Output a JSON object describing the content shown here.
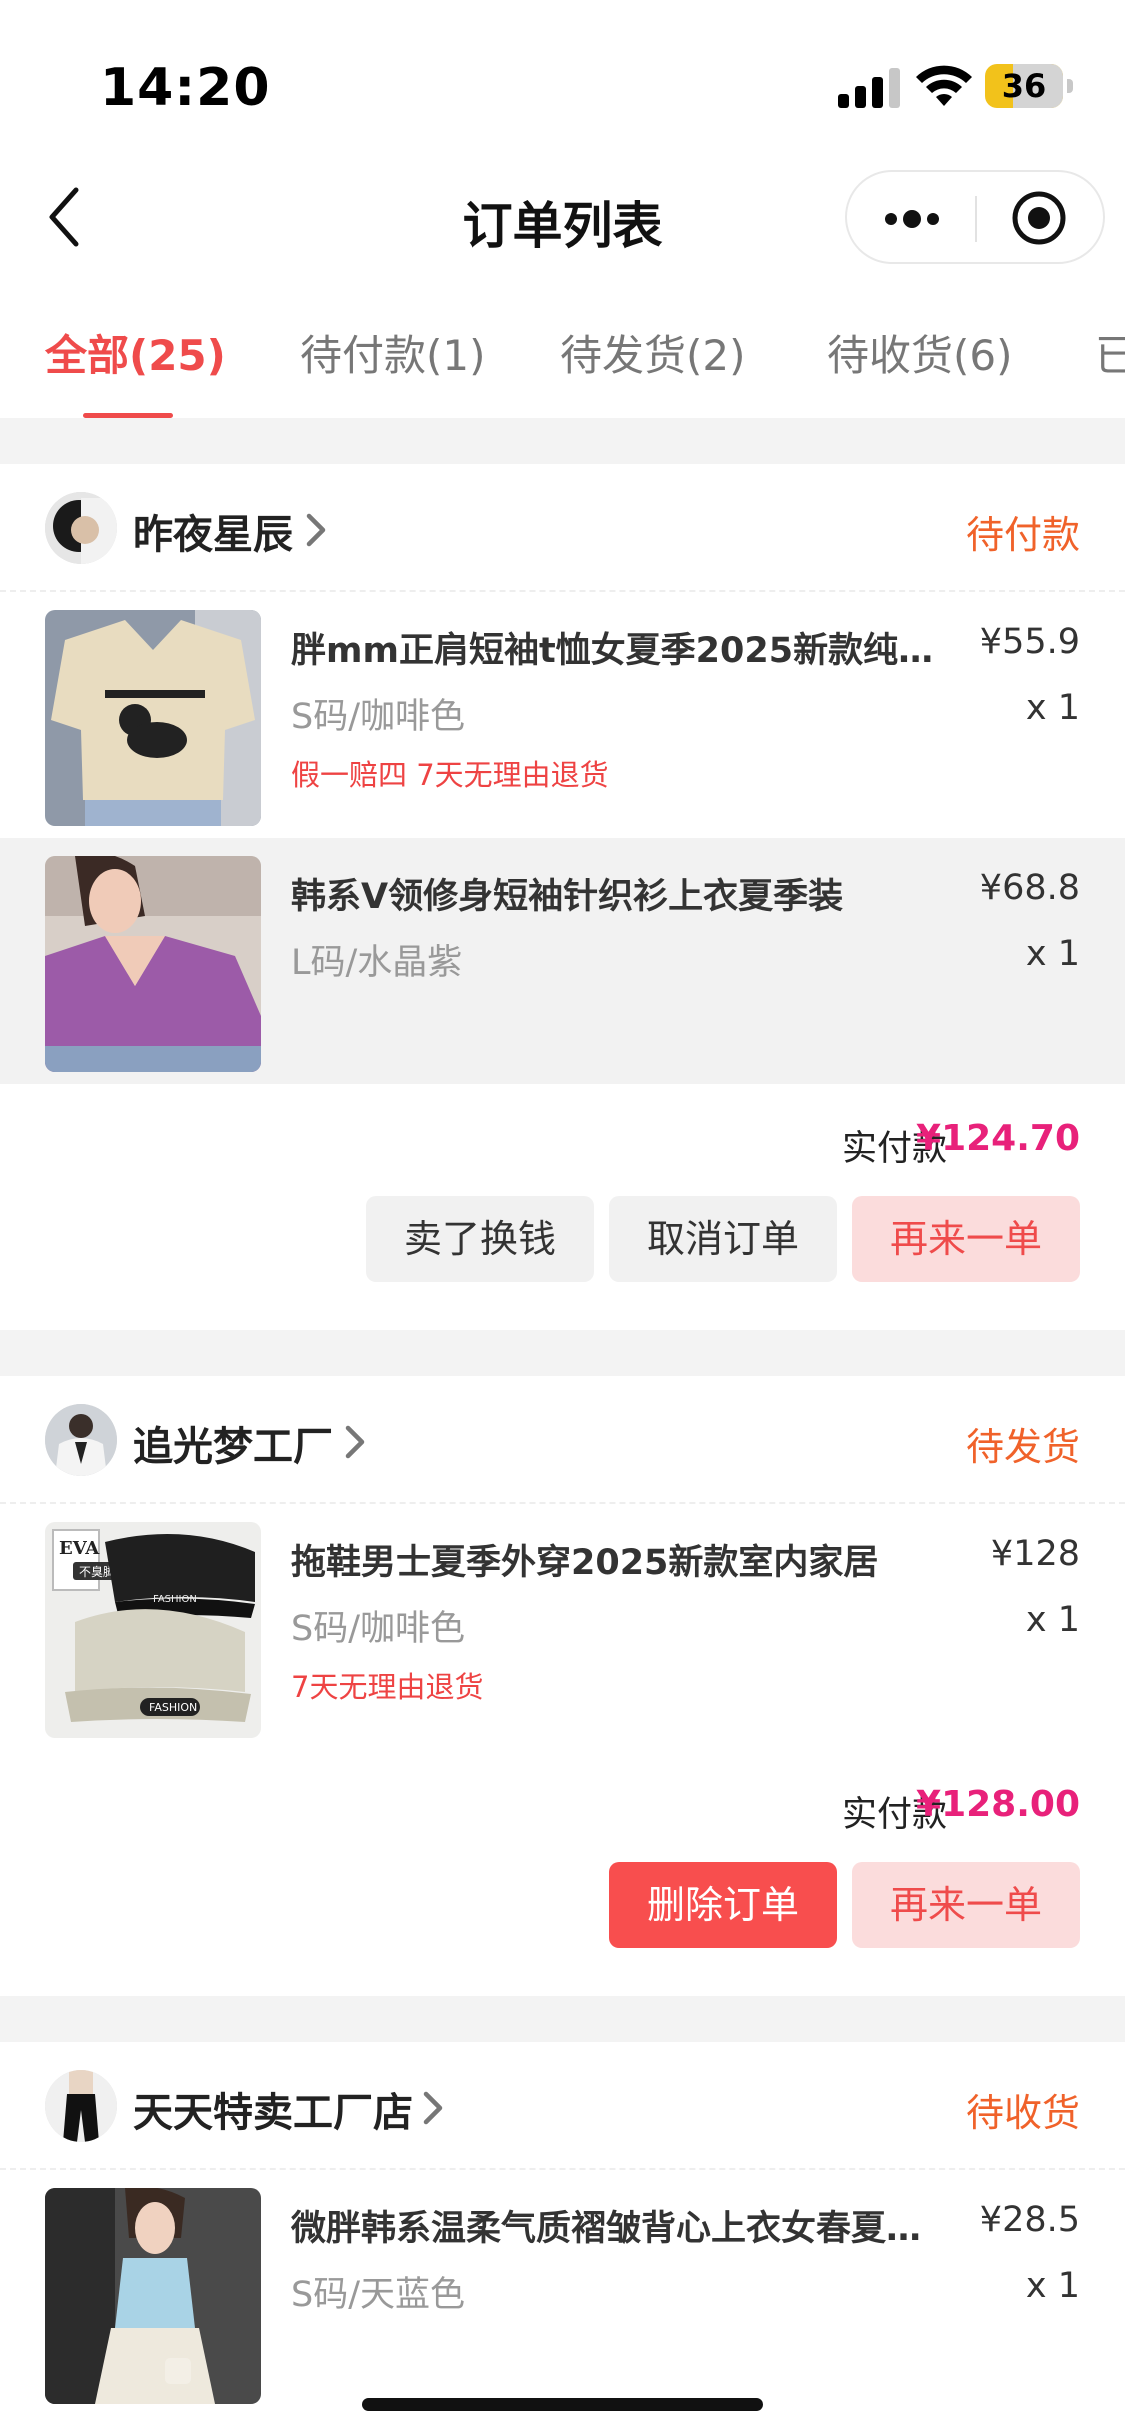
{
  "status_bar": {
    "time": "14:20",
    "battery": "36",
    "battery_color": "#f2c21b"
  },
  "nav": {
    "title": "订单列表"
  },
  "tabs": [
    {
      "label": "全部(25)",
      "active": true
    },
    {
      "label": "待付款(1)"
    },
    {
      "label": "待发货(2)"
    },
    {
      "label": "待收货(6)"
    },
    {
      "label": "已"
    }
  ],
  "orders": [
    {
      "shop": "昨夜星辰",
      "status": "待付款",
      "items": [
        {
          "title": "胖mm正肩短袖t恤女夏季2025新款纯棉…",
          "price": "¥55.9",
          "spec": "S码/咖啡色",
          "qty": "x 1",
          "tags": "假一赔四 7天无理由退货"
        },
        {
          "title": "韩系V领修身短袖针织衫上衣夏季装",
          "price": "¥68.8",
          "spec": "L码/水晶紫",
          "qty": "x 1",
          "tags": ""
        }
      ],
      "total_label": "实付款",
      "total": "¥124.70",
      "buttons": [
        "卖了换钱",
        "取消订单",
        "再来一单"
      ]
    },
    {
      "shop": "追光梦工厂",
      "status": "待发货",
      "items": [
        {
          "title": "拖鞋男士夏季外穿2025新款室内家居",
          "price": "¥128",
          "spec": "S码/咖啡色",
          "qty": "x 1",
          "tags": "7天无理由退货",
          "thumb_text": {
            "brand": "EVA",
            "badge": "不臭脚",
            "print": "FASHION"
          }
        }
      ],
      "total_label": "实付款",
      "total": "¥128.00",
      "buttons": [
        "删除订单",
        "再来一单"
      ]
    },
    {
      "shop": "天天特卖工厂店",
      "status": "待收货",
      "items": [
        {
          "title": "微胖韩系温柔气质褶皱背心上衣女春夏…",
          "price": "¥28.5",
          "spec": "S码/天蓝色",
          "qty": "x 1",
          "tags": ""
        }
      ]
    }
  ],
  "colors": {
    "accent": "#ef4b4b",
    "status_orange": "#f0622a",
    "total_pink": "#e8217a",
    "tag_red": "#ee4343"
  },
  "icons": [
    "back-chevron-icon",
    "more-dots-icon",
    "target-circle-icon",
    "chevron-right-icon",
    "signal-icon",
    "wifi-icon",
    "battery-icon"
  ]
}
